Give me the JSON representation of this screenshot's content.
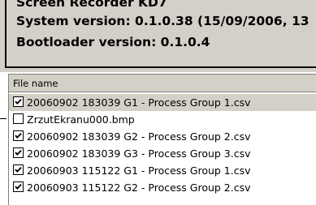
{
  "device_info": {
    "line1": "Screen Recorder KD7",
    "line2": "System version: 0.1.0.38 (15/09/2006, 13",
    "line3": "Bootloader version: 0.1.0.4"
  },
  "file_list": {
    "column_header": "File name",
    "rows": [
      {
        "name": "20060902 183039 G1 - Process Group 1.csv",
        "checked": true,
        "selected": true
      },
      {
        "name": "ZrzutEkranu000.bmp",
        "checked": false,
        "selected": false
      },
      {
        "name": "20060902 183039 G2 - Process Group 2.csv",
        "checked": true,
        "selected": false
      },
      {
        "name": "20060902 183039 G3 - Process Group 3.csv",
        "checked": true,
        "selected": false
      },
      {
        "name": "20060903 115122 G1 - Process Group 1.csv",
        "checked": true,
        "selected": false
      },
      {
        "name": "20060903 115122 G2 - Process Group 2.csv",
        "checked": true,
        "selected": false
      }
    ]
  },
  "colors": {
    "panel_bg": "#d4d0c8",
    "selected_row_bg": "#d4d0c8",
    "text": "#000000"
  }
}
